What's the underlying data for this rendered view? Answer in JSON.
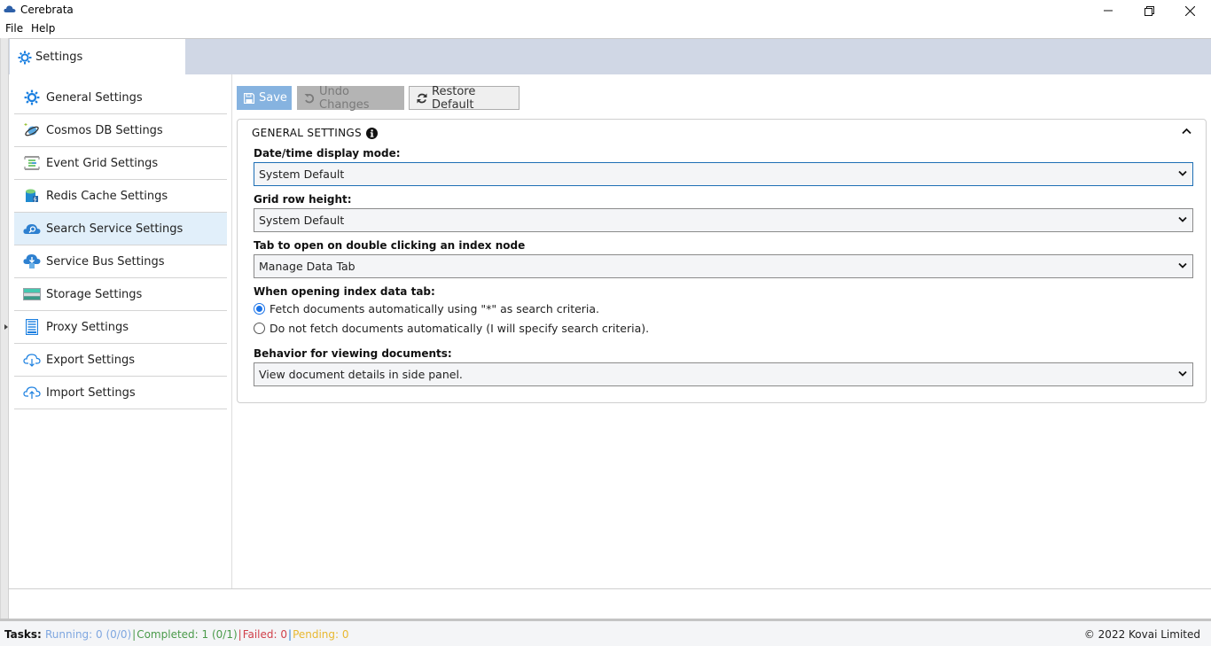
{
  "window": {
    "title": "Cerebrata",
    "app_icon": "cloud-icon",
    "controls": [
      "minimize",
      "restore",
      "close"
    ]
  },
  "menu": {
    "items": [
      "File",
      "Help"
    ]
  },
  "tabs": [
    {
      "label": "Settings",
      "icon": "gear-icon",
      "active": true
    }
  ],
  "sidebar": {
    "items": [
      {
        "label": "General Settings",
        "icon": "gear-icon",
        "active": false
      },
      {
        "label": "Cosmos DB Settings",
        "icon": "cosmos-db-icon",
        "active": false
      },
      {
        "label": "Event Grid Settings",
        "icon": "event-grid-icon",
        "active": false
      },
      {
        "label": "Redis Cache Settings",
        "icon": "redis-cache-icon",
        "active": false
      },
      {
        "label": "Search Service Settings",
        "icon": "search-service-icon",
        "active": true
      },
      {
        "label": "Service Bus Settings",
        "icon": "service-bus-icon",
        "active": false
      },
      {
        "label": "Storage Settings",
        "icon": "storage-icon",
        "active": false
      },
      {
        "label": "Proxy Settings",
        "icon": "proxy-icon",
        "active": false
      },
      {
        "label": "Export Settings",
        "icon": "cloud-download-icon",
        "active": false
      },
      {
        "label": "Import Settings",
        "icon": "cloud-upload-icon",
        "active": false
      }
    ]
  },
  "toolbar": {
    "save_label": "Save",
    "undo_label": "Undo Changes",
    "restore_label": "Restore Default"
  },
  "panel": {
    "title": "GENERAL SETTINGS",
    "fields": {
      "datetime_label": "Date/time display mode:",
      "datetime_value": "System Default",
      "rowheight_label": "Grid row height:",
      "rowheight_value": "System Default",
      "tabopen_label": "Tab to open on double clicking an index node",
      "tabopen_value": "Manage Data Tab",
      "opening_label": "When opening index data tab:",
      "opening_options": [
        {
          "label": "Fetch documents automatically using \"*\" as search criteria.",
          "selected": true
        },
        {
          "label": "Do not fetch documents automatically (I will specify search criteria).",
          "selected": false
        }
      ],
      "behavior_label": "Behavior for viewing documents:",
      "behavior_value": "View document details in side panel."
    }
  },
  "status": {
    "tasks_label": "Tasks",
    "running": "Running: 0 (0/0)",
    "completed": "Completed: 1 (0/1)",
    "failed": "Failed: 0",
    "pending": "Pending: 0",
    "copyright": "© 2022 Kovai Limited",
    "colors": {
      "running": "#7fa7e0",
      "completed": "#4a9a4a",
      "failed": "#d0404a",
      "pending": "#e8b830"
    }
  }
}
